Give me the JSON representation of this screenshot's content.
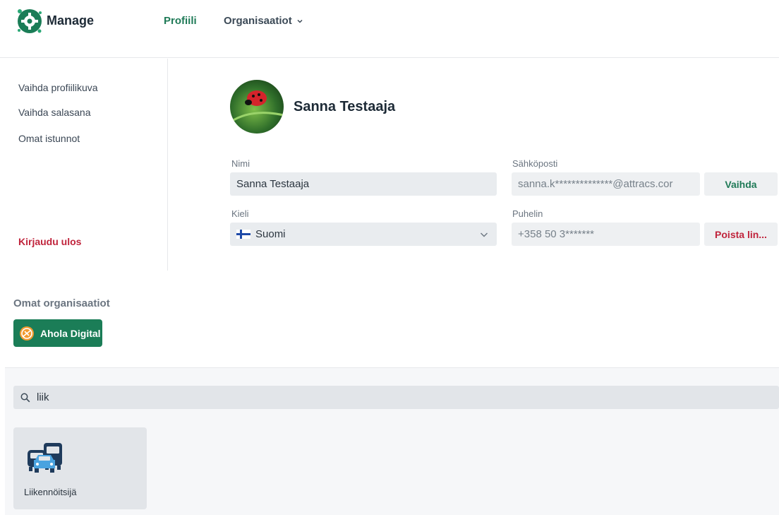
{
  "header": {
    "brand": "Manage",
    "nav_profile": "Profiili",
    "nav_orgs": "Organisaatiot"
  },
  "sidebar": {
    "items": [
      {
        "label": "Vaihda profiilikuva"
      },
      {
        "label": "Vaihda salasana"
      },
      {
        "label": "Omat istunnot"
      }
    ],
    "logout": "Kirjaudu ulos"
  },
  "profile": {
    "name": "Sanna Testaaja"
  },
  "form": {
    "name_label": "Nimi",
    "name_value": "Sanna Testaaja",
    "email_label": "Sähköposti",
    "email_value": "sanna.k**************@attracs.cor",
    "email_button": "Vaihda",
    "language_label": "Kieli",
    "language_value": "Suomi",
    "phone_label": "Puhelin",
    "phone_value": "+358 50 3*******",
    "phone_button": "Poista lin..."
  },
  "organizations": {
    "title": "Omat organisaatiot",
    "items": [
      {
        "label": "Ahola Digital"
      }
    ]
  },
  "search": {
    "value": "liik"
  },
  "apps": [
    {
      "label": "Liikennöitsijä",
      "icon": "vehicles-icon"
    }
  ],
  "colors": {
    "accent_green": "#1f7a57",
    "danger_red": "#c0243c",
    "org_green": "#1b7d57"
  }
}
